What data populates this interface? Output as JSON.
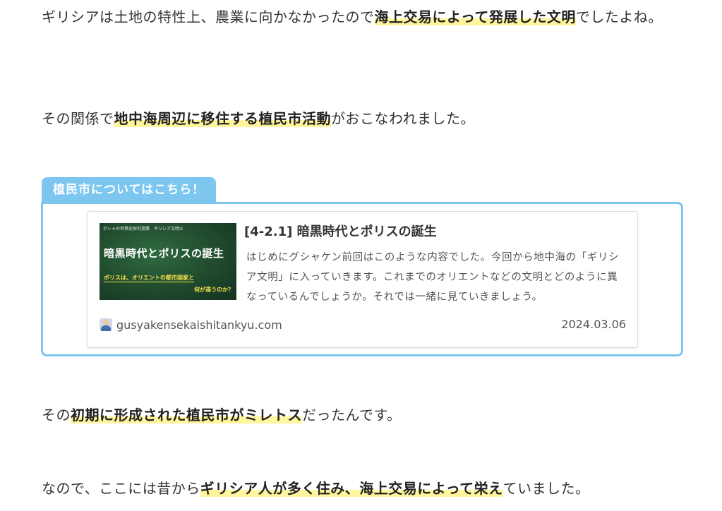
{
  "paragraphs": {
    "p1": {
      "before": "ギリシアは土地の特性上、農業に向かなかったので",
      "highlight": "海上交易によって発展した文明",
      "after": "でしたよね。"
    },
    "p2": {
      "before": "その関係で",
      "highlight": "地中海周辺に移住する植民市活動",
      "after": "がおこなわれました。"
    },
    "p3": {
      "before": "その",
      "highlight": "初期に形成された植民市がミレトス",
      "after": "だったんです。"
    },
    "p4": {
      "before": "なので、ここには昔から",
      "highlight": "ギリシア人が多く住み、海上交易によって栄え",
      "after": "ていました。"
    }
  },
  "related_box": {
    "tab_label": "植民市についてはこちら！",
    "card": {
      "thumbnail": {
        "top_text": "グシャの世界史探究授業　ギリシア文明①",
        "title": "暗黒時代とポリスの誕生",
        "sub1": "ポリスは、オリエントの都市国家と",
        "sub2": "何が違うのか？"
      },
      "title": "[4-2.1] 暗黒時代とポリスの誕生",
      "excerpt": "はじめにグシャケン前回はこのような内容でした。今回から地中海の「ギリシア文明」に入っていきます。これまでのオリエントなどの文明とどのように異なっているんでしょうか。それでは一緒に見ていきましょう。",
      "site": "gusyakensekaishitankyu.com",
      "date": "2024.03.06",
      "favicon_icon": "avatar-favicon-icon"
    }
  },
  "colors": {
    "highlight": "#fff59d",
    "box_accent": "#7cc6f0",
    "text": "#333333"
  }
}
